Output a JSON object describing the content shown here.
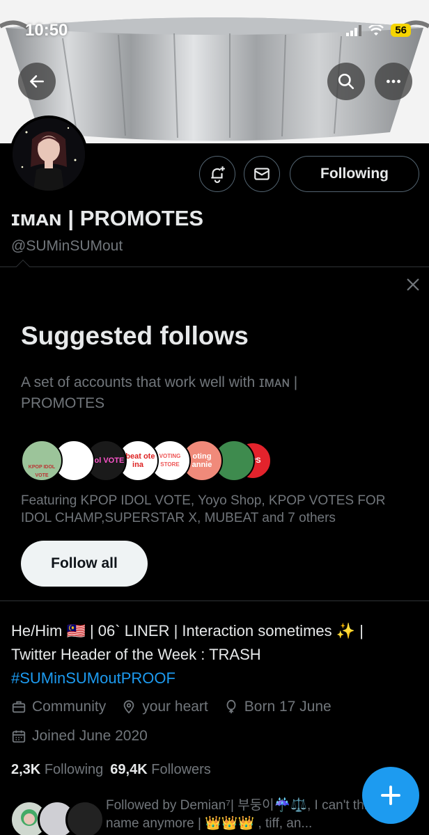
{
  "status_bar": {
    "time": "10:50",
    "battery": "56",
    "icons": [
      "signal-icon",
      "wifi-icon",
      "battery-icon"
    ]
  },
  "header": {
    "back_icon": "arrow-left-icon",
    "search_icon": "search-icon",
    "more_icon": "more-horizontal-icon"
  },
  "profile": {
    "display_name": "ɪᴍᴀɴ | PROMOTES",
    "handle": "@SUMinSUMout",
    "following_button": "Following",
    "notify_icon": "bell-plus-icon",
    "message_icon": "envelope-icon"
  },
  "suggested": {
    "title": "Suggested follows",
    "subtitle": "A set of accounts that work well with ɪᴍᴀɴ | PROMOTES",
    "face_labels": [
      "KPOP IDOL VOTE",
      "",
      "Idol VOTE",
      "ubeat ote ina",
      "VOTING STORE",
      "oting annie",
      "",
      "OPS"
    ],
    "featuring": "Featuring KPOP IDOL VOTE, Yoyo Shop, KPOP VOTES FOR IDOL CHAMP,SUPERSTAR X, MUBEAT and 7 others",
    "follow_all": "Follow all",
    "close_icon": "close-icon"
  },
  "bio": {
    "line1": "He/Him 🇲🇾 | 06` LINER | Interaction sometimes ✨ |",
    "line2": "Twitter Header of the Week : TRASH",
    "hashtag": "#SUMinSUMoutPROOF"
  },
  "meta": {
    "category": "Community",
    "location": "your heart",
    "birthday": "Born 17 June",
    "joined": "Joined June 2020"
  },
  "stats": {
    "following_count": "2,3K",
    "following_label": "Following",
    "followers_count": "69,4K",
    "followers_label": "Followers"
  },
  "followed_by": {
    "text": "Followed by Demian⁷| 부둥이☔️⚖️, I can't think of a name anymore | 👑👑👑 , tiff, an..."
  },
  "fab": {
    "icon": "plus-icon"
  },
  "colors": {
    "accent": "#1d9bf0",
    "background": "#000000",
    "muted_text": "#71767b",
    "divider": "#2f3336"
  }
}
